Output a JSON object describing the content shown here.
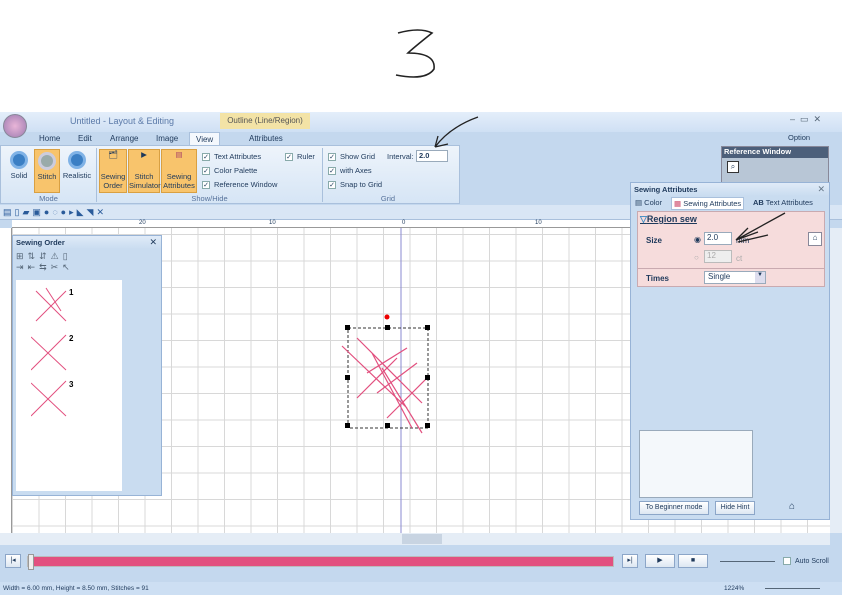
{
  "annotation": {
    "step_number": "3"
  },
  "window": {
    "title": "Untitled - Layout & Editing",
    "context_tab": "Outline (Line/Region)",
    "option": "Option"
  },
  "tabs": [
    "Home",
    "Edit",
    "Arrange",
    "Image",
    "View",
    "Attributes"
  ],
  "ribbon": {
    "mode": {
      "label": "Mode",
      "buttons": [
        "Solid",
        "Stitch",
        "Realistic"
      ]
    },
    "showhide": {
      "label": "Show/Hide",
      "buttons": [
        "Sewing Order",
        "Stitch Simulator",
        "Sewing Attributes"
      ],
      "checks": [
        "Text Attributes",
        "Color Palette",
        "Reference Window",
        "Ruler"
      ]
    },
    "grid": {
      "label": "Grid",
      "checks": [
        "Show Grid",
        "with Axes",
        "Snap to Grid"
      ],
      "interval_label": "Interval:",
      "interval_value": "2.0"
    }
  },
  "ruler": {
    "ticks": [
      "20",
      "10",
      "0",
      "10"
    ]
  },
  "sewing_order": {
    "title": "Sewing Order",
    "items": [
      "1",
      "2",
      "3"
    ]
  },
  "reference_window": {
    "title": "Reference Window"
  },
  "sewing_attributes": {
    "title": "Sewing Attributes",
    "tabs": [
      "Color",
      "Sewing Attributes",
      "Text Attributes"
    ],
    "section": "Region sew",
    "size_label": "Size",
    "size_value": "2.0",
    "size_unit": "mm",
    "size_alt_value": "12",
    "size_alt_unit": "ct",
    "times_label": "Times",
    "times_value": "Single",
    "beginner_button": "To Beginner mode",
    "hide_hint_button": "Hide Hint"
  },
  "playback": {
    "progress": 1.0,
    "auto_scroll": "Auto Scroll",
    "color": "#e2507f"
  },
  "status": {
    "text": "Width = 6.00 mm, Height = 8.50 mm, Stitches = 91",
    "zoom": "1224%"
  }
}
